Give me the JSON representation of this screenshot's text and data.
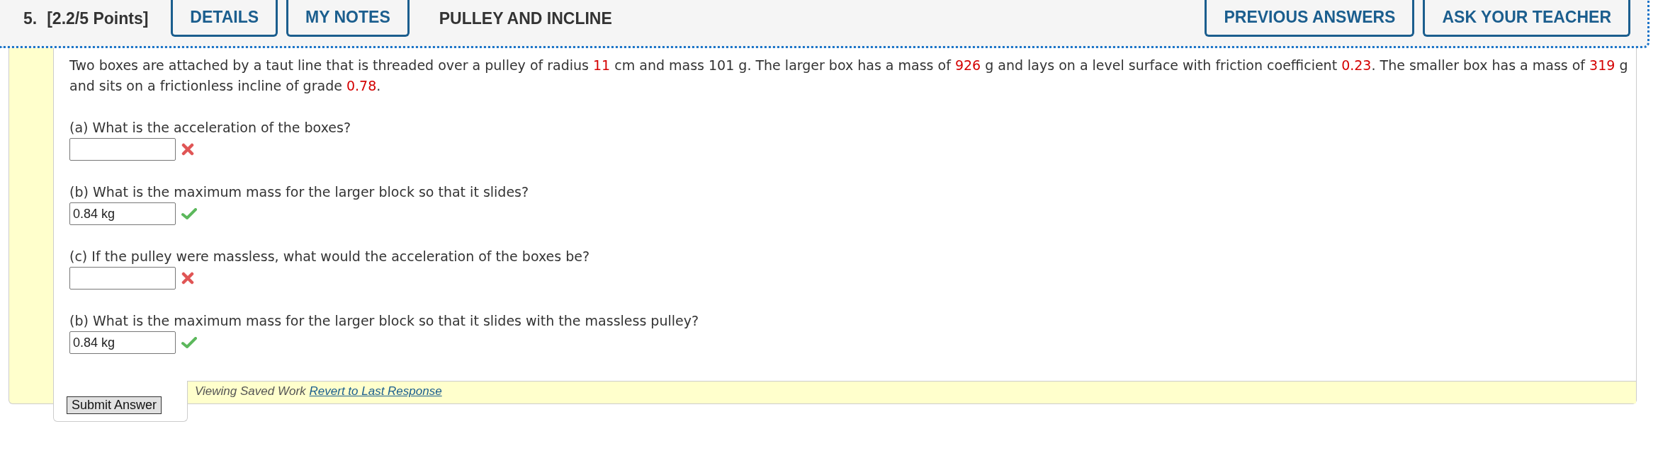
{
  "header": {
    "number": "5.",
    "points": "[2.2/5 Points]",
    "buttons_left": [
      "DETAILS",
      "MY NOTES"
    ],
    "title": "PULLEY AND INCLINE",
    "buttons_right": [
      "PREVIOUS ANSWERS",
      "ASK YOUR TEACHER"
    ]
  },
  "problem": [
    {
      "kind": "text",
      "text": "Two boxes are attached by a taut line that is threaded over a pulley of radius "
    },
    {
      "kind": "value",
      "text": "11"
    },
    {
      "kind": "text",
      "text": " cm and mass 101 g. The larger box has a mass of "
    },
    {
      "kind": "value",
      "text": "926"
    },
    {
      "kind": "text",
      "text": " g and lays on a level surface with friction coefficient "
    },
    {
      "kind": "value",
      "text": "0.23"
    },
    {
      "kind": "text",
      "text": ". The smaller box has a mass of "
    },
    {
      "kind": "value",
      "text": "319"
    },
    {
      "kind": "text",
      "text": " g and sits on a frictionless incline of grade "
    },
    {
      "kind": "value",
      "text": "0.78"
    },
    {
      "kind": "text",
      "text": "."
    }
  ],
  "parts": [
    {
      "question": "(a) What is the acceleration of the boxes?",
      "correct": false
    },
    {
      "question": "(b) What is the maximum mass for the larger block so that it slides?",
      "answer": "0.84 kg",
      "correct": true
    },
    {
      "question": "(c) If the pulley were massless, what would the acceleration of the boxes be?",
      "correct": false
    },
    {
      "question": "(b) What is the maximum mass for the larger block so that it slides with the massless pulley?",
      "answer": "0.84 kg",
      "correct": true
    }
  ],
  "submit_button": "Submit Answer",
  "saved_work": {
    "label": "Viewing Saved Work",
    "link": "Revert to Last Response"
  }
}
